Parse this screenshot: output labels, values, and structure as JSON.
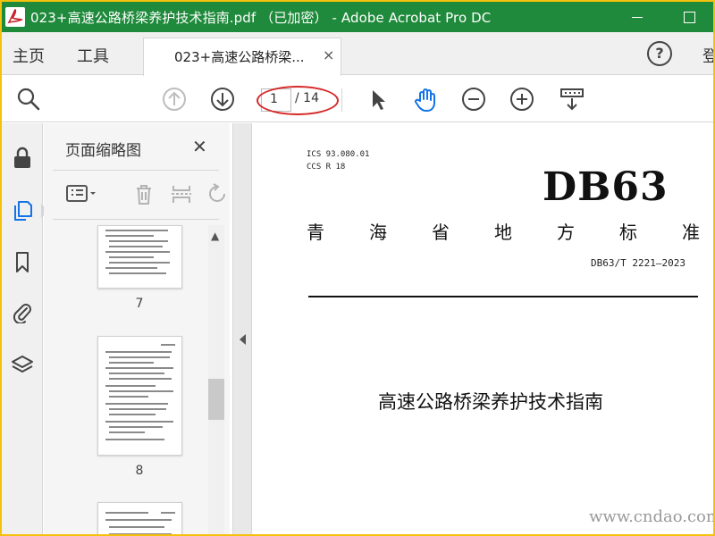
{
  "window": {
    "title": "023+高速公路桥梁养护技术指南.pdf （已加密） - Adobe Acrobat Pro DC"
  },
  "tabs": {
    "home": "主页",
    "tools": "工具",
    "document_tab": "023+高速公路桥梁...",
    "close_glyph": "×",
    "help_glyph": "?",
    "signin": "登"
  },
  "toolbar": {
    "current_page": "1",
    "total_pages": "/ 14"
  },
  "thumbnails": {
    "title": "页面缩略图",
    "close_glyph": "✕",
    "scroll_up_glyph": "▲",
    "pages": [
      {
        "number": "7"
      },
      {
        "number": "8"
      }
    ]
  },
  "document": {
    "ics": "ICS  93.080.01",
    "ccs": "CCS  R 18",
    "logo": "DB63",
    "province_title": [
      "青",
      "海",
      "省",
      "地",
      "方",
      "标",
      "准"
    ],
    "standard_no": "DB63/T 2221—2023",
    "title": "高速公路桥梁养护技术指南"
  },
  "watermark": "www.cndao.com",
  "colors": {
    "titlebar": "#1f8a3b",
    "accent_blue": "#1473e6",
    "highlight_red": "#d62a2a",
    "frame_yellow": "#f4c20d"
  }
}
